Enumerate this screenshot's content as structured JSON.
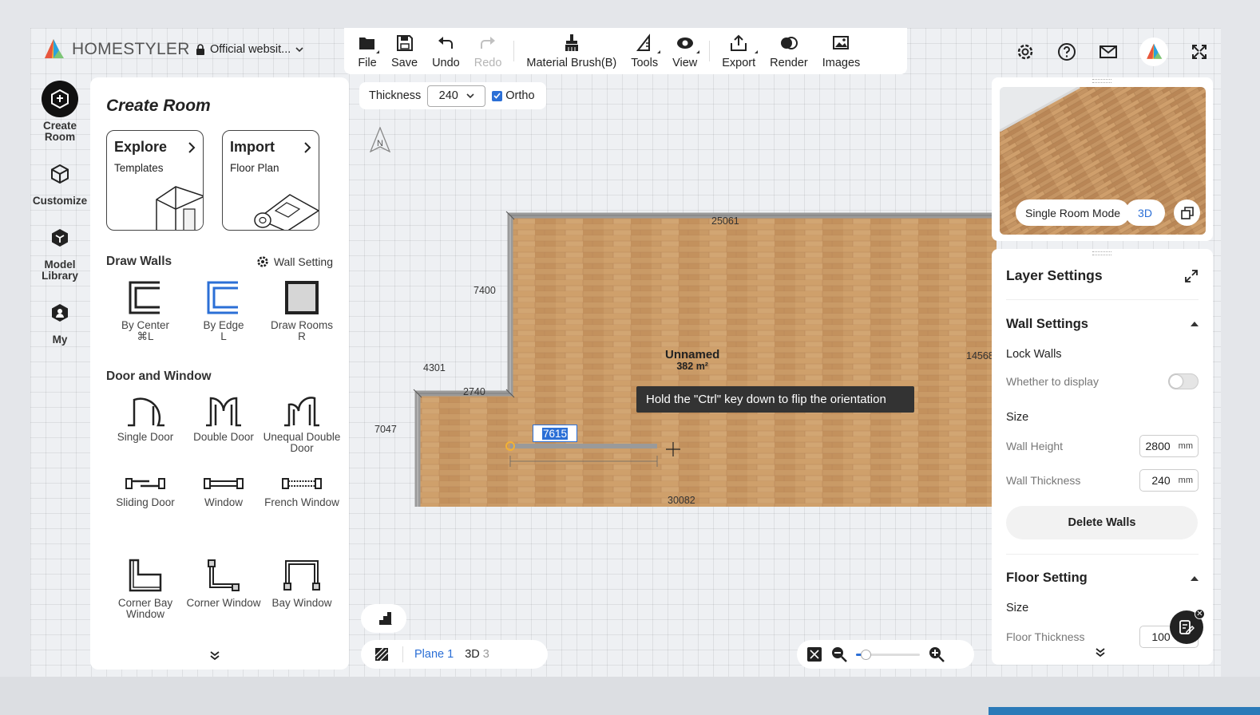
{
  "brand": {
    "name": "HOMESTYLER"
  },
  "project": {
    "name": "Official websit..."
  },
  "toolbar": {
    "file": "File",
    "save": "Save",
    "undo": "Undo",
    "redo": "Redo",
    "material_brush": "Material Brush(B)",
    "tools": "Tools",
    "view": "View",
    "export": "Export",
    "render": "Render",
    "images": "Images"
  },
  "rail": {
    "create_room": "Create Room",
    "customize": "Customize",
    "model_library": "Model Library",
    "my": "My"
  },
  "panel": {
    "title": "Create Room",
    "explore": {
      "title": "Explore",
      "subtitle": "Templates"
    },
    "import": {
      "title": "Import",
      "subtitle": "Floor Plan"
    },
    "draw_walls": {
      "heading": "Draw Walls",
      "wall_setting": "Wall Setting",
      "tools": [
        {
          "label": "By Center",
          "shortcut": "⌘L"
        },
        {
          "label": "By Edge",
          "shortcut": "L"
        },
        {
          "label": "Draw Rooms",
          "shortcut": "R"
        }
      ]
    },
    "door_window": {
      "heading": "Door and Window",
      "items": [
        "Single Door",
        "Double Door",
        "Unequal Double Door",
        "Sliding Door",
        "Window",
        "French Window",
        "Corner Bay Window",
        "Corner Window",
        "Bay Window"
      ]
    }
  },
  "canvas": {
    "thickness_label": "Thickness",
    "thickness_value": "240",
    "ortho_label": "Ortho",
    "ortho_checked": true,
    "compass": "N",
    "room": {
      "name": "Unnamed",
      "area": "382 m²"
    },
    "dimensions": {
      "top": "25061",
      "right": "14568",
      "bottom": "30082",
      "left_upper": "7400",
      "left_lower": "7047",
      "notch_top": "4301",
      "notch_side": "2740"
    },
    "tooltip": "Hold the \"Ctrl\" key down to flip the orientation",
    "length_input": "7615",
    "plane": "Plane 1",
    "view3d": "3D",
    "view3d_count": "3",
    "zoom_level": 0.15
  },
  "preview": {
    "mode": "Single Room Mode",
    "view": "3D"
  },
  "layers": {
    "title": "Layer Settings",
    "wall_settings": "Wall Settings",
    "lock_walls": "Lock Walls",
    "whether_display": "Whether to display",
    "lock_on": false,
    "size": "Size",
    "wall_height_label": "Wall Height",
    "wall_height": "2800",
    "wall_thickness_label": "Wall Thickness",
    "wall_thickness": "240",
    "unit": "mm",
    "delete_walls": "Delete Walls",
    "floor_setting": "Floor Setting",
    "floor_size": "Size",
    "floor_thickness_label": "Floor Thickness",
    "floor_thickness": "100"
  },
  "colors": {
    "accent": "#2b6fd6",
    "floor": "#c9965f",
    "wall": "#9a9a9a"
  }
}
